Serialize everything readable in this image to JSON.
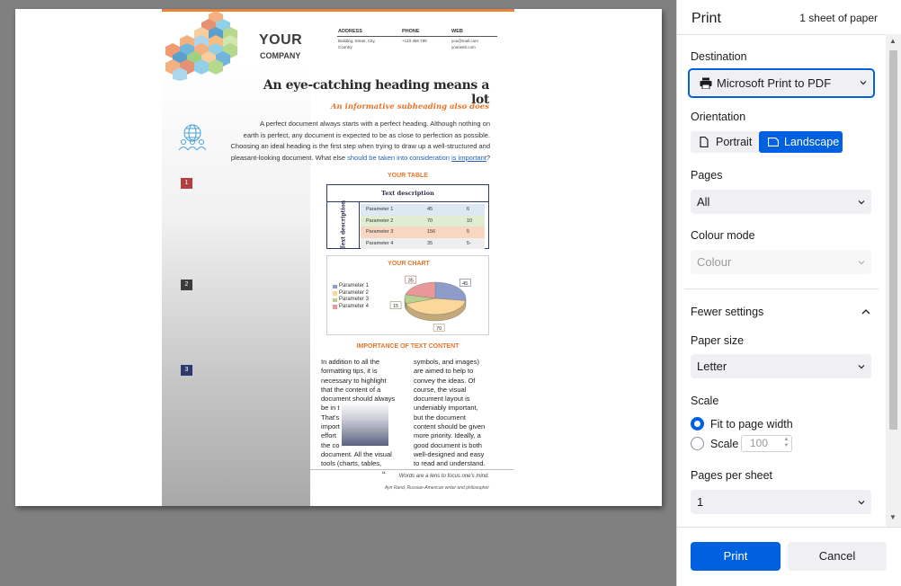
{
  "panel": {
    "title": "Print",
    "sheet_count": "1 sheet of paper",
    "destination_label": "Destination",
    "destination_value": "Microsoft Print to PDF",
    "orientation_label": "Orientation",
    "portrait": "Portrait",
    "landscape": "Landscape",
    "orientation_selected": "Landscape",
    "pages_label": "Pages",
    "pages_value": "All",
    "colour_label": "Colour mode",
    "colour_value": "Colour",
    "fewer_settings": "Fewer settings",
    "paper_size_label": "Paper size",
    "paper_size_value": "Letter",
    "scale_label": "Scale",
    "fit_label": "Fit to page width",
    "scale_option": "Scale",
    "scale_value": "100",
    "pages_per_sheet_label": "Pages per sheet",
    "pages_per_sheet_value": "1",
    "print_button": "Print",
    "cancel_button": "Cancel",
    "accent": "#0061e0"
  },
  "document": {
    "company_your": "YOUR",
    "company_name": "COMPANY",
    "address_label": "ADDRESS",
    "address_value_1": "Building, Street, City,",
    "address_value_2": "Country",
    "phone_label": "PHONE",
    "phone_value": "+123 456 789",
    "web_label": "WEB",
    "web_value_1": "you@mail.com",
    "web_value_2": "yourweb.com",
    "heading": "An eye-catching heading means a lot",
    "subheading": "An informative subheading also does",
    "intro_1": "A perfect document always starts with a perfect heading. Although nothing on",
    "intro_2": "earth is perfect, any document is expected to be as close to perfection as possible.",
    "intro_3": "Choosing an ideal heading is the first step when trying to draw up a well-structured and",
    "intro_4": "pleasant-looking document. What else",
    "intro_link_1": "should be taken into consideration",
    "intro_link_2": "is important",
    "intro_end": "?",
    "num_1": "1",
    "num_2": "2",
    "num_3": "3",
    "table_title": "YOUR TABLE",
    "table_header": "Text description",
    "table_side": "Text description",
    "table_rows": [
      {
        "label": "Parameter 1",
        "a": "45",
        "b": "6",
        "color": "#dce9f3"
      },
      {
        "label": "Parameter 2",
        "a": "70",
        "b": "10",
        "color": "#e0edd2"
      },
      {
        "label": "Parameter 3",
        "a": "156",
        "b": "5",
        "color": "#f8d7c2"
      },
      {
        "label": "Parameter 4",
        "a": "35",
        "b": "5-",
        "color": "#eeeeee"
      }
    ],
    "chart_title": "YOUR CHART",
    "section_title": "IMPORTANCE OF TEXT CONTENT",
    "col1": [
      "In addition to all the",
      "formatting tips, it is",
      "necessary to highlight",
      "that the content of a",
      "document should always",
      "be in t",
      "That's",
      "import",
      "effort",
      "the co",
      "document. All the visual",
      "tools (charts, tables,"
    ],
    "col1_right": [
      "",
      "",
      "",
      "",
      "",
      "",
      "",
      "he",
      "",
      "o",
      "",
      ""
    ],
    "col2": [
      "symbols, and images)",
      "are aimed to help to",
      "convey the ideas. Of",
      "course, the visual",
      "document layout is",
      "undeniably important,",
      "but the document",
      "content should be given",
      "more priority. Ideally, a",
      "good document is both",
      "well-designed and easy",
      "to read and understand."
    ],
    "quote": "Words are a lens to focus one's mind.",
    "quote_mark": "“",
    "author": "Ayn Rand, Russian-American writer and philosopher"
  },
  "chart_data": {
    "type": "pie",
    "title": "YOUR CHART",
    "categories": [
      "Parameter 1",
      "Parameter 2",
      "Parameter 3",
      "Parameter 4"
    ],
    "values": [
      45,
      70,
      15,
      35
    ],
    "colors": [
      "#8e9cc9",
      "#fbd89a",
      "#b8d08c",
      "#e89898"
    ],
    "legend": "left"
  }
}
